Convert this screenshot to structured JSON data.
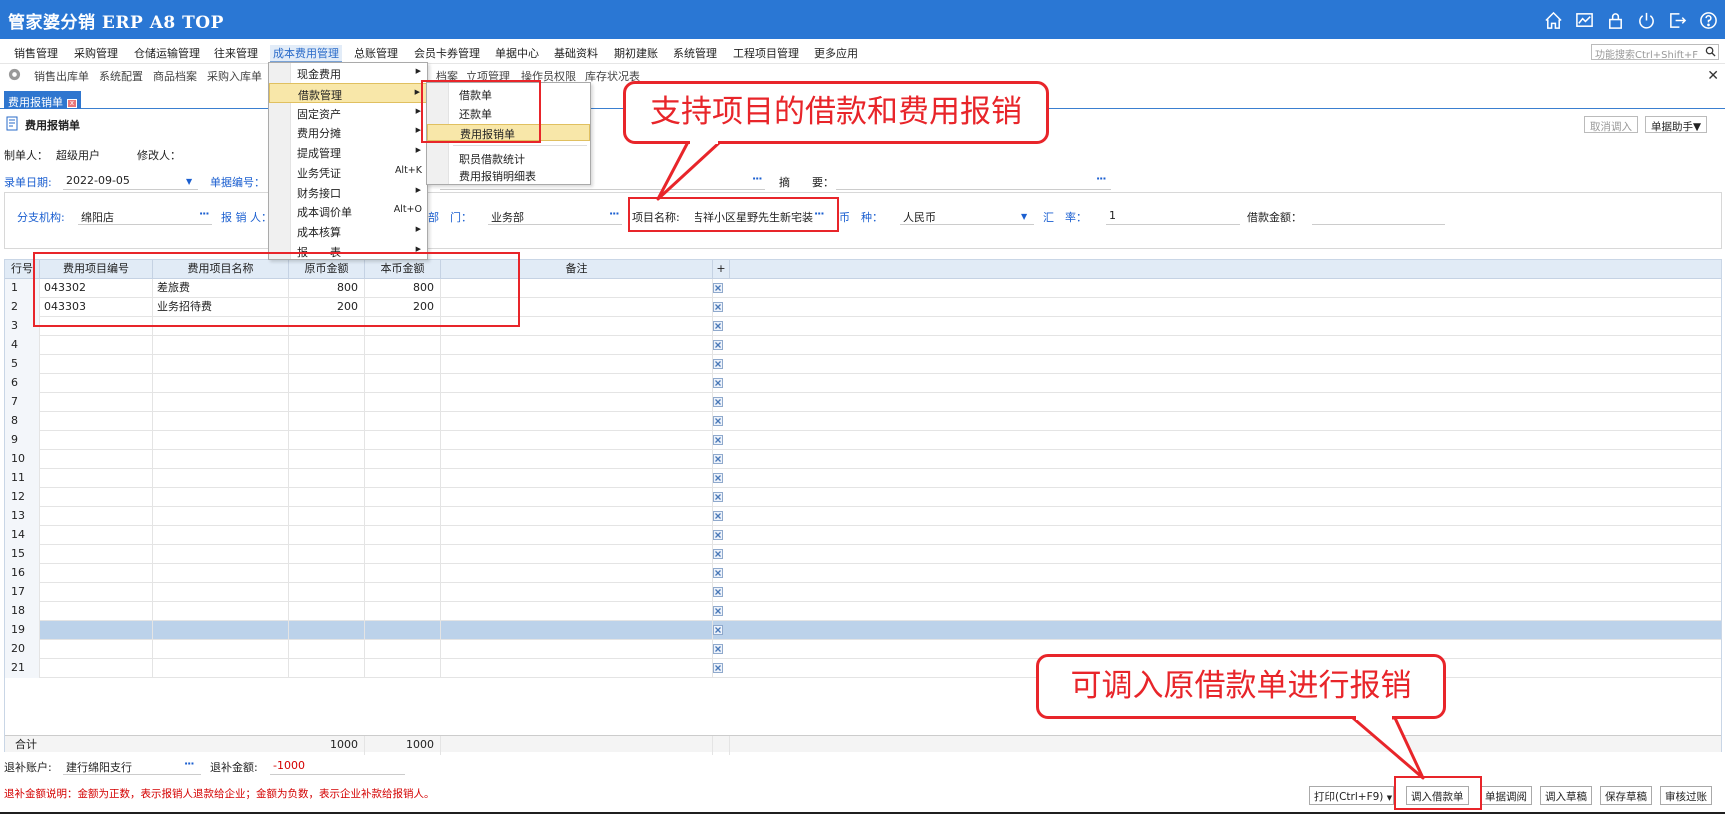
{
  "app": {
    "title": "管家婆分销 ERP A8 TOP"
  },
  "title_icons": [
    "home-icon",
    "chart-icon",
    "lock-icon",
    "power-icon",
    "logout-icon",
    "help-icon"
  ],
  "menubar": [
    "销售管理",
    "采购管理",
    "仓储运输管理",
    "往来管理",
    "成本费用管理",
    "总账管理",
    "会员卡券管理",
    "单据中心",
    "基础资料",
    "期初建账",
    "系统管理",
    "工程项目管理",
    "更多应用"
  ],
  "search": {
    "placeholder": "功能搜索Ctrl+Shift+F"
  },
  "quickbar": [
    "销售出库单",
    "系统配置",
    "商品档案",
    "采购入库单",
    "档案",
    "立项管理",
    "操作员权限",
    "库存状况表"
  ],
  "tab": {
    "label": "费用报销单"
  },
  "page": {
    "title": "费用报销单",
    "cancel_import": "取消调入",
    "helper": "单据助手▼"
  },
  "form": {
    "creator_label": "制单人：",
    "creator": "超级用户",
    "modifier_label": "修改人：",
    "date_label": "录单日期:",
    "date": "2022-09-05",
    "docno_label": "单据编号：",
    "summary_label": "摘　　要：",
    "branch_label": "分支机构:",
    "branch": "绵阳店",
    "reporter_label": "报 销 人：",
    "dept_label": "部　门：",
    "dept": "业务部",
    "project_label": "项目名称:",
    "project": "吉祥小区星野先生新宅装",
    "currency_label": "币　种：",
    "currency": "人民币",
    "rate_label": "汇　率：",
    "rate": "1",
    "loan_label": "借款金额："
  },
  "grid": {
    "headers": [
      "行号",
      "费用项目编号",
      "费用项目名称",
      "原币金额",
      "本币金额",
      "备注",
      "+"
    ],
    "rows": [
      {
        "no": "1",
        "code": "043302",
        "name": "差旅费",
        "orig": "800",
        "local": "800"
      },
      {
        "no": "2",
        "code": "043303",
        "name": "业务招待费",
        "orig": "200",
        "local": "200"
      },
      {
        "no": "3"
      },
      {
        "no": "4"
      },
      {
        "no": "5"
      },
      {
        "no": "6"
      },
      {
        "no": "7"
      },
      {
        "no": "8"
      },
      {
        "no": "9"
      },
      {
        "no": "10"
      },
      {
        "no": "11"
      },
      {
        "no": "12"
      },
      {
        "no": "13"
      },
      {
        "no": "14"
      },
      {
        "no": "15"
      },
      {
        "no": "16"
      },
      {
        "no": "17"
      },
      {
        "no": "18"
      },
      {
        "no": "19"
      },
      {
        "no": "20"
      },
      {
        "no": "21"
      }
    ],
    "selected_row": "19",
    "total": {
      "label": "合计",
      "orig": "1000",
      "local": "1000"
    }
  },
  "bottom": {
    "account_label": "退补账户:",
    "account": "建行绵阳支行",
    "amount_label": "退补金额:",
    "amount": "-1000",
    "note": "退补金额说明：金额为正数，表示报销人退款给企业；金额为负数，表示企业补款给报销人。",
    "buttons": [
      "打印(Ctrl+F9)",
      "调入借款单",
      "单据调阅",
      "调入草稿",
      "保存草稿",
      "审核过账"
    ]
  },
  "menu_cost": {
    "items": [
      {
        "label": "现金费用",
        "arrow": "▶"
      },
      {
        "label": "借款管理",
        "arrow": "▶"
      },
      {
        "label": "固定资产",
        "arrow": "▶"
      },
      {
        "label": "费用分摊",
        "arrow": "▶"
      },
      {
        "label": "提成管理",
        "arrow": "▶"
      },
      {
        "label": "业务凭证",
        "shortcut": "Alt+K"
      },
      {
        "label": "财务接口",
        "arrow": "▶"
      },
      {
        "label": "成本调价单",
        "shortcut": "Alt+O"
      },
      {
        "label": "成本核算",
        "arrow": "▶"
      },
      {
        "label": "报　　表",
        "arrow": "▶"
      }
    ]
  },
  "menu_loan": {
    "items": [
      "借款单",
      "还款单",
      "费用报销单",
      "职员借款统计",
      "费用报销明细表"
    ]
  },
  "callouts": {
    "top": "支持项目的借款和费用报销",
    "bottom": "可调入原借款单进行报销"
  },
  "colors": {
    "titlebar": "#2a77d4",
    "accent_red": "#e8252a",
    "label_blue": "#1b5fd0",
    "selected_row": "#bcd2ea"
  }
}
